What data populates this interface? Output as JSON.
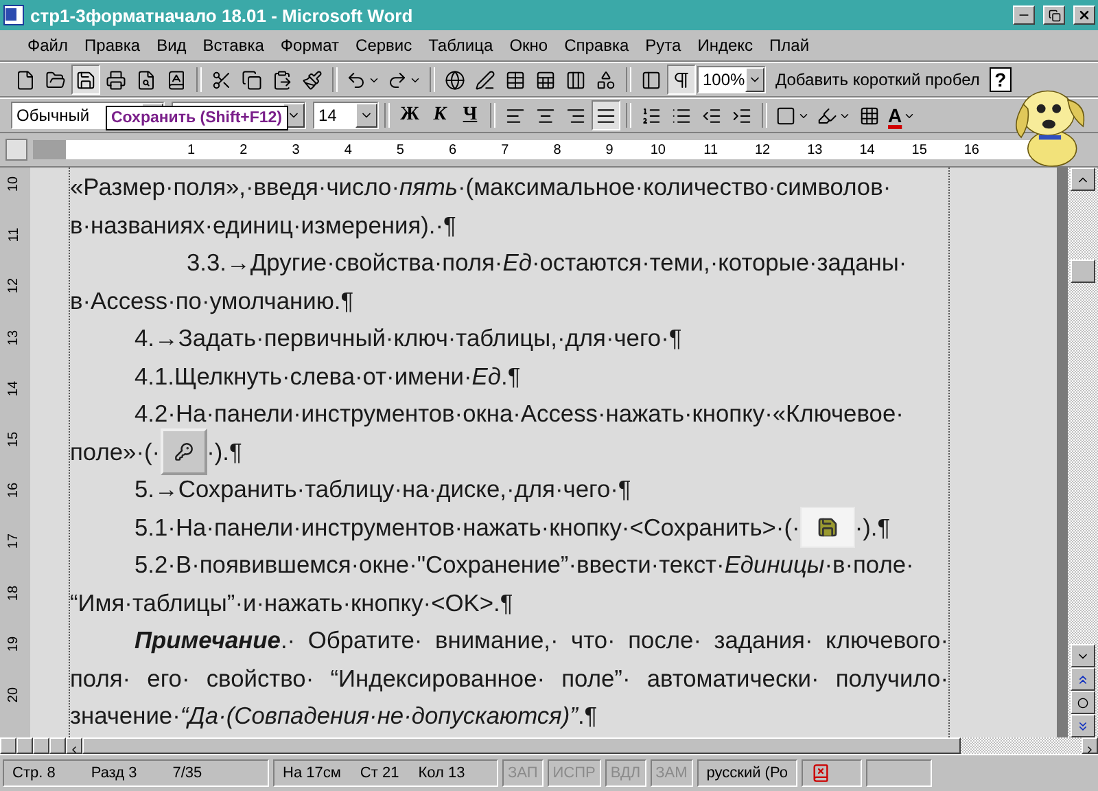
{
  "window": {
    "title": "стр1-3форматначало 18.01 - Microsoft Word"
  },
  "menu": [
    "Файл",
    "Правка",
    "Вид",
    "Вставка",
    "Формат",
    "Сервис",
    "Таблица",
    "Окно",
    "Справка",
    "Рута",
    "Индекс",
    "Плай"
  ],
  "standard_toolbar": {
    "buttons": [
      {
        "pressed": false
      },
      {
        "pressed": false
      },
      {
        "pressed": true
      },
      {
        "pressed": false
      },
      {
        "pressed": false
      },
      {
        "pressed": false
      },
      {
        "pressed": false
      },
      {
        "pressed": false
      },
      {
        "pressed": false
      },
      {
        "pressed": false
      },
      {
        "pressed": false
      },
      {
        "pressed": false
      },
      {
        "pressed": false
      },
      {
        "pressed": false
      },
      {
        "pressed": false
      },
      {
        "pressed": false
      },
      {
        "pressed": false
      },
      {
        "pressed": false
      },
      {
        "pressed": false
      },
      {
        "pressed": true
      }
    ],
    "zoom": "100%",
    "command": "Добавить короткий пробел",
    "help": "?"
  },
  "formatting_toolbar": {
    "style": "Обычный",
    "size": "14",
    "text_buttons": [
      {
        "label": "Ж",
        "pressed": false
      },
      {
        "label": "К",
        "pressed": false
      },
      {
        "label": "Ч",
        "pressed": false
      }
    ],
    "buttons": [
      {
        "pressed": false
      },
      {
        "pressed": false
      },
      {
        "pressed": false
      },
      {
        "pressed": true
      },
      {
        "pressed": false
      },
      {
        "pressed": false
      },
      {
        "pressed": false
      },
      {
        "pressed": false
      },
      {
        "pressed": false
      },
      {
        "pressed": false
      },
      {
        "pressed": false
      }
    ],
    "font_color": "A"
  },
  "tooltip": "Сохранить (Shift+F12)",
  "ruler": [
    "1",
    "2",
    "3",
    "4",
    "5",
    "6",
    "7",
    "8",
    "9",
    "10",
    "11",
    "12",
    "13",
    "14",
    "15",
    "16"
  ],
  "vertical_ruler": [
    "10",
    "11",
    "12",
    "13",
    "14",
    "15",
    "16",
    "17",
    "18",
    "19",
    "20"
  ],
  "document": {
    "lines": [
      {
        "kind": "plain",
        "segments": [
          {
            "kind": "text",
            "text": "«Размер·поля»,·введя·число·*пять*·(максимальное·количество·символов·"
          }
        ]
      },
      {
        "kind": "plain",
        "segments": [
          {
            "kind": "text",
            "text": "в·названиях·единиц·измерения).·¶"
          }
        ]
      },
      {
        "kind": "deep",
        "segments": [
          {
            "kind": "text",
            "text": "3.3.→Другие·свойства·поля·*Ед*·остаются·теми,·которые·заданы·"
          }
        ]
      },
      {
        "kind": "plain",
        "segments": [
          {
            "kind": "text",
            "text": "в·Access·по·умолчанию.¶"
          }
        ]
      },
      {
        "kind": "first-line",
        "segments": [
          {
            "kind": "text",
            "text": "4.→Задать·первичный·ключ·таблицы,·для·чего·¶"
          }
        ]
      },
      {
        "kind": "first-line",
        "segments": [
          {
            "kind": "text",
            "text": "4.1.Щелкнуть·слева·от·имени·*Ед*.¶"
          }
        ]
      },
      {
        "kind": "first-line",
        "segments": [
          {
            "kind": "text",
            "text": "4.2·На·панели·инструментов·окна·Access·нажать·кнопку·«Ключевое·"
          }
        ]
      },
      {
        "kind": "plain",
        "segments": [
          {
            "kind": "text",
            "text": "поле»·(·"
          },
          {
            "kind": "key-button"
          },
          {
            "kind": "text",
            "text": "·).¶"
          }
        ]
      },
      {
        "kind": "first-line",
        "segments": [
          {
            "kind": "text",
            "text": "5.→Сохранить·таблицу·на·диске,·для·чего·¶"
          }
        ]
      },
      {
        "kind": "first-line",
        "segments": [
          {
            "kind": "text",
            "text": "5.1·На·панели·инструментов·нажать·кнопку·<Сохранить>·(·"
          },
          {
            "kind": "save-button"
          },
          {
            "kind": "text",
            "text": "·).¶"
          }
        ]
      },
      {
        "kind": "first-line",
        "segments": [
          {
            "kind": "text",
            "text": "5.2·В·появившемся·окне·\"Сохранение”·ввести·текст·*Единицы*·в·поле·"
          }
        ]
      },
      {
        "kind": "plain",
        "segments": [
          {
            "kind": "text",
            "text": "“Имя·таблицы”·и·нажать·кнопку·<OK>.¶"
          }
        ]
      },
      {
        "kind": "first-line-justified",
        "segments": [
          {
            "kind": "text",
            "text": "**Примечание**.· Обратите· внимание,· что· после· задания· ключевого·"
          }
        ]
      },
      {
        "kind": "plain-justified",
        "segments": [
          {
            "kind": "text",
            "text": "поля· его· свойство· “Индексированное· поле”· автоматически· получило·"
          }
        ]
      },
      {
        "kind": "plain",
        "segments": [
          {
            "kind": "text",
            "text": "значение·*“Да·(Совпадения·не·допускаются)”*.¶"
          }
        ]
      }
    ]
  },
  "status_bar": {
    "position": [
      "Стр. 8",
      "Разд 3",
      "7/35"
    ],
    "cursor": [
      "На 17см",
      "Ст 21",
      "Кол 13"
    ],
    "indicators": [
      {
        "label": "ЗАП",
        "active": false
      },
      {
        "label": "ИСПР",
        "active": false
      },
      {
        "label": "ВДЛ",
        "active": false
      },
      {
        "label": "ЗАМ",
        "active": false
      }
    ],
    "language": "русский (Ро"
  }
}
